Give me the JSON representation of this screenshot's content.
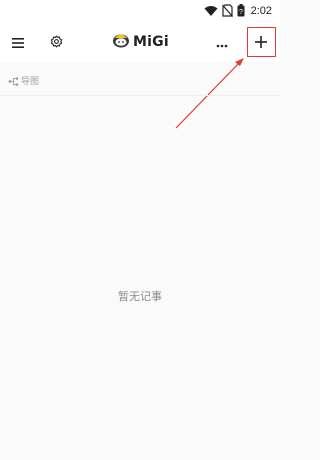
{
  "status_bar": {
    "time": "2:02",
    "icons": [
      "wifi-icon",
      "no-sim-icon",
      "battery-icon"
    ]
  },
  "app_bar": {
    "logo_text": "MiGi",
    "menu_icon": "menu-icon",
    "settings_icon": "gear-icon",
    "more_icon": "more-icon",
    "add_icon": "plus-icon"
  },
  "nav": {
    "guide_label": "导图",
    "guide_icon": "mindmap-icon"
  },
  "main": {
    "empty_message": "暂无记事"
  },
  "colors": {
    "annotation": "#e53935",
    "background": "#fafafa",
    "app_bar": "#ffffff"
  }
}
